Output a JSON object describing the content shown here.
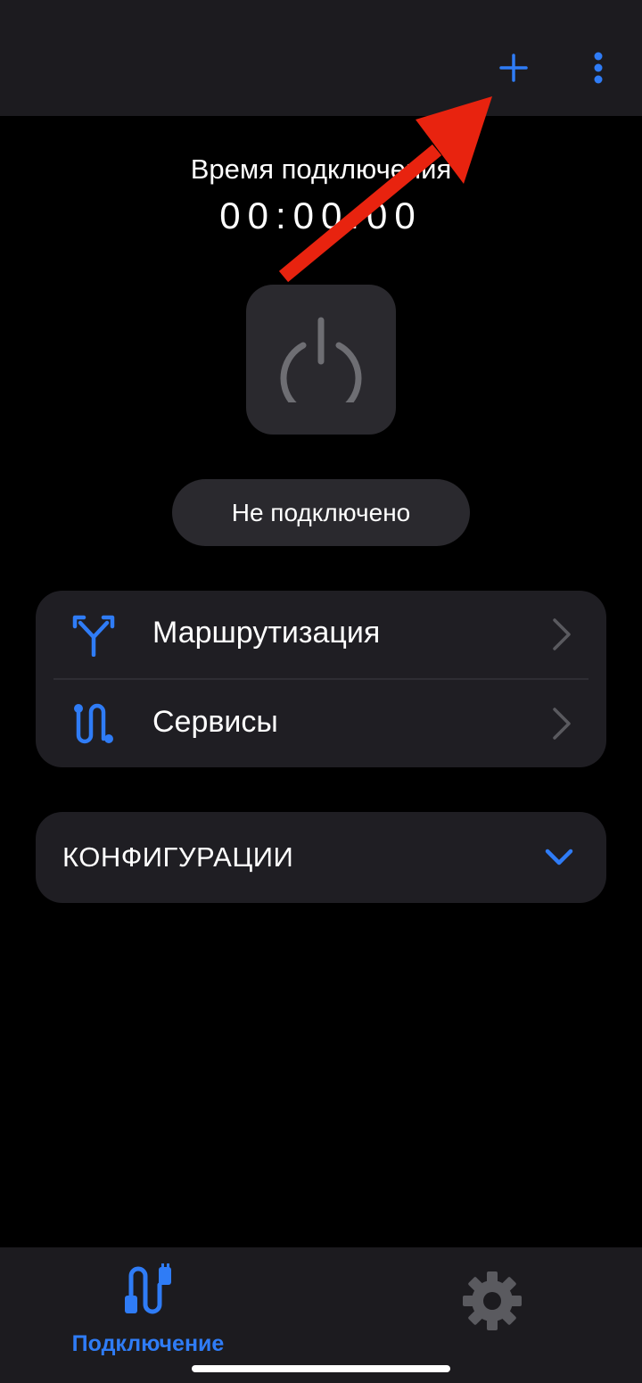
{
  "header": {
    "add_icon": "plus-icon",
    "menu_icon": "more-vertical-icon"
  },
  "connection": {
    "time_label": "Время подключения",
    "time_value": "00:00.00",
    "power_icon": "power-icon",
    "status": "Не подключено"
  },
  "menu": {
    "items": [
      {
        "label": "Маршрутизация",
        "icon": "routing-split-icon"
      },
      {
        "label": "Сервисы",
        "icon": "services-path-icon"
      }
    ]
  },
  "configurations": {
    "label": "КОНФИГУРАЦИИ",
    "icon": "chevron-down-icon"
  },
  "bottom_nav": {
    "items": [
      {
        "label": "Подключение",
        "icon": "plug-icon",
        "active": true
      },
      {
        "label": "",
        "icon": "gear-icon",
        "active": false
      }
    ]
  },
  "colors": {
    "accent": "#2f7cf6",
    "background": "#000000",
    "surface": "#1f1e23",
    "bar": "#1c1b1f",
    "annotation_arrow": "#e8230f"
  }
}
